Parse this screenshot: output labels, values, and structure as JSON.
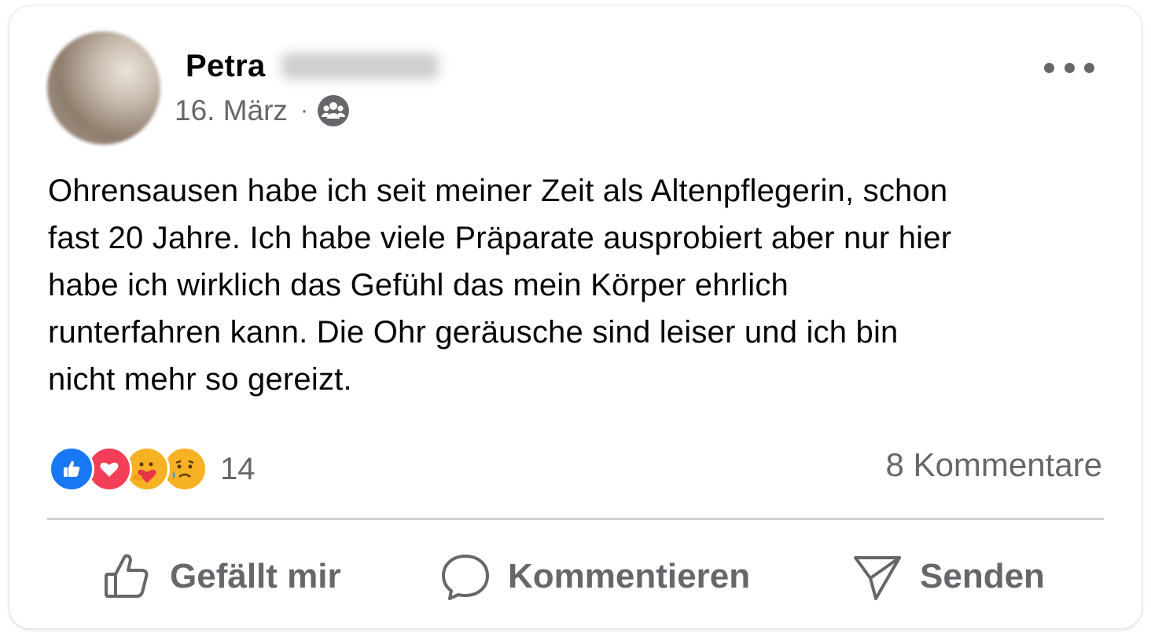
{
  "post": {
    "author_first_name": "Petra",
    "date": "16. März",
    "separator": "·",
    "audience_icon": "friends-group-icon",
    "text_lines": [
      "Ohrensausen habe ich seit meiner Zeit als Altenpflegerin, schon",
      "fast 20 Jahre. Ich habe viele Präparate ausprobiert aber nur hier",
      "habe ich wirklich das Gefühl das mein Körper ehrlich",
      "runterfahren kann. Die Ohr geräusche sind leiser und ich bin",
      "nicht mehr so gereizt."
    ]
  },
  "reactions": {
    "types": [
      "like",
      "love",
      "care",
      "sad"
    ],
    "count": "14",
    "comments_label": "8 Kommentare"
  },
  "actions": {
    "like_label": "Gefällt mir",
    "comment_label": "Kommentieren",
    "send_label": "Senden"
  },
  "colors": {
    "text_primary": "#050505",
    "text_secondary": "#65676b",
    "like_blue": "#1877f2",
    "love_red": "#f33e58",
    "emoji_yellow": "#f7b125",
    "divider": "#ced0d4"
  }
}
